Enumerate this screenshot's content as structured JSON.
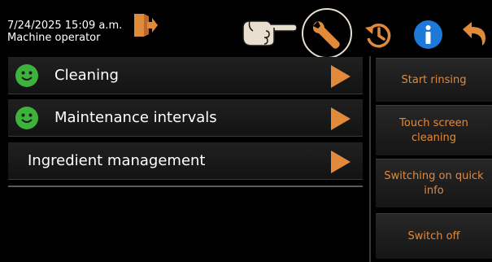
{
  "status": {
    "datetime": "7/24/2025 15:09 a.m.",
    "role": "Machine operator"
  },
  "toolbar": {
    "icons": [
      "logout-icon",
      "pointing-hand-icon",
      "wrench-icon",
      "history-icon",
      "info-icon",
      "back-icon"
    ]
  },
  "menu": {
    "items": [
      {
        "label": "Cleaning",
        "status_icon": "smiley-icon",
        "status_color": "#3db33b"
      },
      {
        "label": "Maintenance intervals",
        "status_icon": "smiley-icon",
        "status_color": "#3db33b"
      },
      {
        "label": "Ingredient management"
      }
    ]
  },
  "side_buttons": [
    {
      "label": "Start rinsing"
    },
    {
      "label": "Touch screen cleaning"
    },
    {
      "label": "Switching on quick info"
    },
    {
      "label": "Switch off"
    }
  ],
  "colors": {
    "accent": "#e28a3c",
    "info": "#1e78d7",
    "ok": "#3db33b",
    "background": "#000000"
  }
}
